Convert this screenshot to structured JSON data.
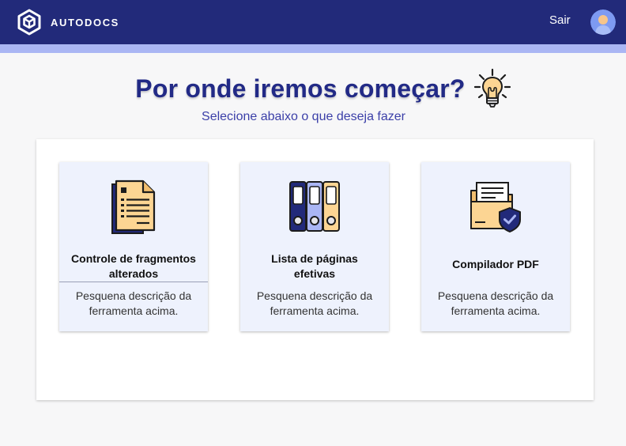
{
  "header": {
    "brand": "AUTODOCS",
    "logout_label": "Sair"
  },
  "hero": {
    "title": "Por onde iremos começar?",
    "subtitle": "Selecione abaixo o que deseja fazer"
  },
  "tools": [
    {
      "title_line1": "Controle de fragmentos",
      "title_line2": "alterados",
      "description_line1": "Pesquena descrição da",
      "description_line2": "ferramenta acima.",
      "icon": "document-list-icon"
    },
    {
      "title_line1": "Lista de páginas",
      "title_line2": "efetivas",
      "description_line1": "Pesquena descrição da",
      "description_line2": "ferramenta acima.",
      "icon": "binders-icon"
    },
    {
      "title_line1": "Compilador PDF",
      "description_line1": "Pesquena descrição da",
      "description_line2": "ferramenta acima.",
      "icon": "secure-folder-icon"
    }
  ],
  "colors": {
    "primary": "#222a7a",
    "accent_strip": "#aab6f4",
    "title": "#222a86",
    "card_bg": "#eef2fd",
    "icon_fill": "#fcd593"
  }
}
